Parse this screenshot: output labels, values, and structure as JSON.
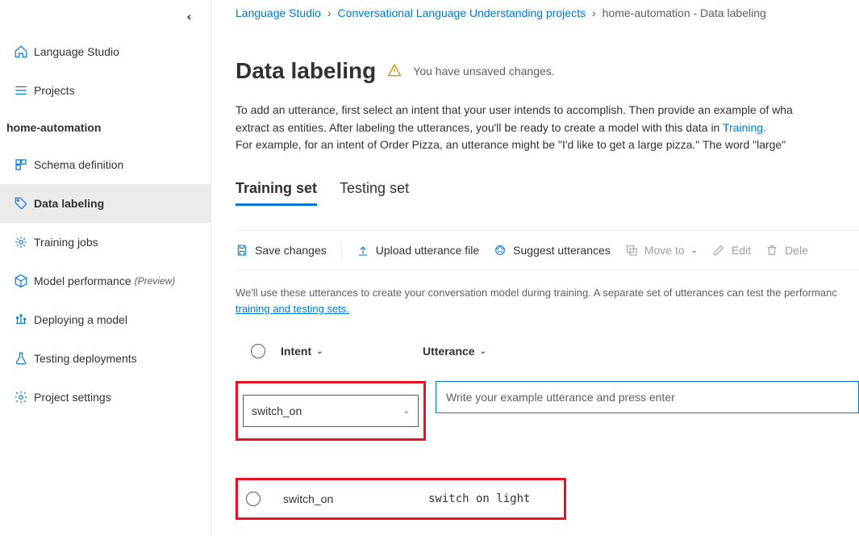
{
  "sidebar": {
    "top": [
      {
        "label": "Language Studio"
      },
      {
        "label": "Projects"
      }
    ],
    "project_name": "home-automation",
    "items": [
      {
        "label": "Schema definition"
      },
      {
        "label": "Data labeling"
      },
      {
        "label": "Training jobs"
      },
      {
        "label": "Model performance",
        "preview": "(Preview)"
      },
      {
        "label": "Deploying a model"
      },
      {
        "label": "Testing deployments"
      },
      {
        "label": "Project settings"
      }
    ]
  },
  "breadcrumb": {
    "items": [
      {
        "label": "Language Studio",
        "link": true
      },
      {
        "label": "Conversational Language Understanding projects",
        "link": true
      },
      {
        "label": "home-automation - Data labeling",
        "link": false
      }
    ]
  },
  "page": {
    "title": "Data labeling",
    "unsaved": "You have unsaved changes.",
    "instr1a": "To add an utterance, first select an intent that your user intends to accomplish. Then provide an example of wha",
    "instr1b": "extract as entities. After labeling the utterances, you'll be ready to create a model with this data in ",
    "training_link": "Training.",
    "instr2": "For example, for an intent of Order Pizza, an utterance might be \"I'd like to get a large pizza.\" The word \"large\" "
  },
  "tabs": {
    "training": "Training set",
    "testing": "Testing set"
  },
  "toolbar": {
    "save": "Save changes",
    "upload": "Upload utterance file",
    "suggest": "Suggest utterances",
    "moveto": "Move to",
    "edit": "Edit",
    "delete": "Dele"
  },
  "hint": {
    "text": "We'll use these utterances to create your conversation model during training. A separate set of utterances can test the performanc",
    "link": "training and testing sets."
  },
  "columns": {
    "intent": "Intent",
    "utterance": "Utterance"
  },
  "input": {
    "intent_selected": "switch_on",
    "utter_placeholder": "Write your example utterance and press enter"
  },
  "rows": [
    {
      "intent": "switch_on",
      "utterance": "switch on light"
    }
  ]
}
